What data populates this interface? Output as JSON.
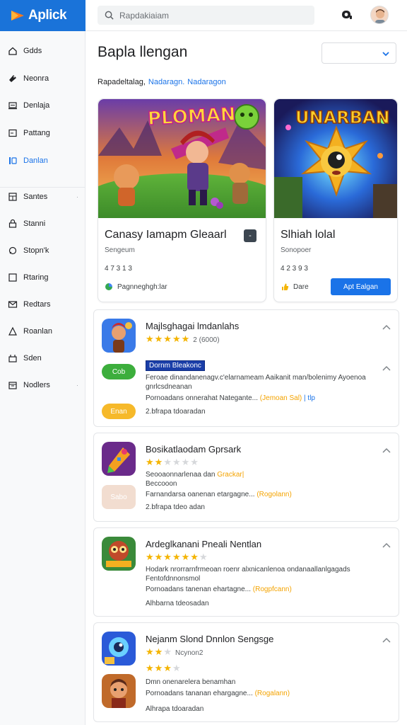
{
  "app": {
    "name": "Aplick"
  },
  "search": {
    "placeholder": "Rapdakiaiam"
  },
  "sidebar": {
    "items": [
      {
        "label": "Gdds",
        "icon": "home-icon"
      },
      {
        "label": "Neonra",
        "icon": "tag-icon"
      },
      {
        "label": "Denlaja",
        "icon": "laptop-icon"
      },
      {
        "label": "Pattang",
        "icon": "box-icon"
      },
      {
        "label": "Danlan",
        "icon": "bookmark-icon"
      },
      {
        "label": "Santes",
        "icon": "grid-icon"
      },
      {
        "label": "Stanni",
        "icon": "lock-icon"
      },
      {
        "label": "Stopn'k",
        "icon": "search-icon"
      },
      {
        "label": "Rtaring",
        "icon": "square-icon"
      },
      {
        "label": "Redtars",
        "icon": "mail-icon"
      },
      {
        "label": "Roanlan",
        "icon": "person-icon"
      },
      {
        "label": "Sden",
        "icon": "store-icon"
      },
      {
        "label": "Nodlers",
        "icon": "calendar-icon"
      }
    ]
  },
  "main": {
    "title": "Bapla llengan",
    "filters": {
      "label": "Rapadeltalag,",
      "links": [
        "Nadaragn.",
        "Nadaragon"
      ]
    }
  },
  "featured": [
    {
      "art_title": "PLOMAN",
      "title": "Canasy Iamapm Gleaarl",
      "subtitle": "Sengeum",
      "rating": "4 7 3 1 3",
      "developer": "Pagnneghgh:lar",
      "action": "-"
    },
    {
      "art_title": "UNARBAN",
      "title": "Slhiah lolal",
      "subtitle": "Sonopoer",
      "rating": "4 2 3 9 3",
      "developer": "Dare",
      "action": "Apt Ealgan"
    }
  ],
  "cards": [
    {
      "title": "Majlsghagai lmdanlahs",
      "rating_text": "2 (6000)",
      "stars": 5,
      "badge": "Dornm Bleakonc",
      "desc1": "Feroae dinandanenagv.c'elarnameam Aaikanit man/bolenimy Ayoenoa",
      "desc2": "gnrlcsdneanan",
      "desc3a": "Pornoadans onnerahat Nategante...",
      "desc3b": "(Jemoan Sal)",
      "desc3c": "| tlp",
      "meta": "2.bfrapa tdoaradan",
      "pill": "Enan",
      "pill2": "Cob"
    },
    {
      "title": "Bosikatlaodam Gprsark",
      "stars": 2,
      "desc1a": "Seooaonnarlenaa dan ",
      "desc1b": "Grackar|",
      "desc2": "Beccooon",
      "desc3a": "Farnandarsa oanenan etargagne...",
      "desc3b": "(Rogolann)",
      "meta": "2.bfrapa tdeo adan",
      "pill": "Sabo"
    },
    {
      "title": "Ardeglkanani Pneali Nentlan",
      "stars": 6,
      "desc1": "Hodark nrorrarnfrmeoan roenr alxnicanlenoa ondanaallanlgagads",
      "desc2": "Fentofdnnonsmol",
      "desc3a": "Pornoadans tanenan ehartagne...",
      "desc3b": "(Rogpfcann)",
      "meta": "Alhbarna tdeosadan"
    },
    {
      "title": "Nejanm Slond Dnnlon Sengsge",
      "stars": 2,
      "stars_label": "Ncynon2",
      "stars2": 3,
      "desc1": "Dmn onenarelera benamhan",
      "desc3a": "Pornoadans tananan ehargagne...",
      "desc3b": "(Rogalann)",
      "meta": "Alhrapa tdoaradan"
    }
  ],
  "colors": {
    "brand": "#1a73d9",
    "accent": "#1a73e8",
    "star": "#f4b400",
    "highlight": "#f4a300"
  }
}
